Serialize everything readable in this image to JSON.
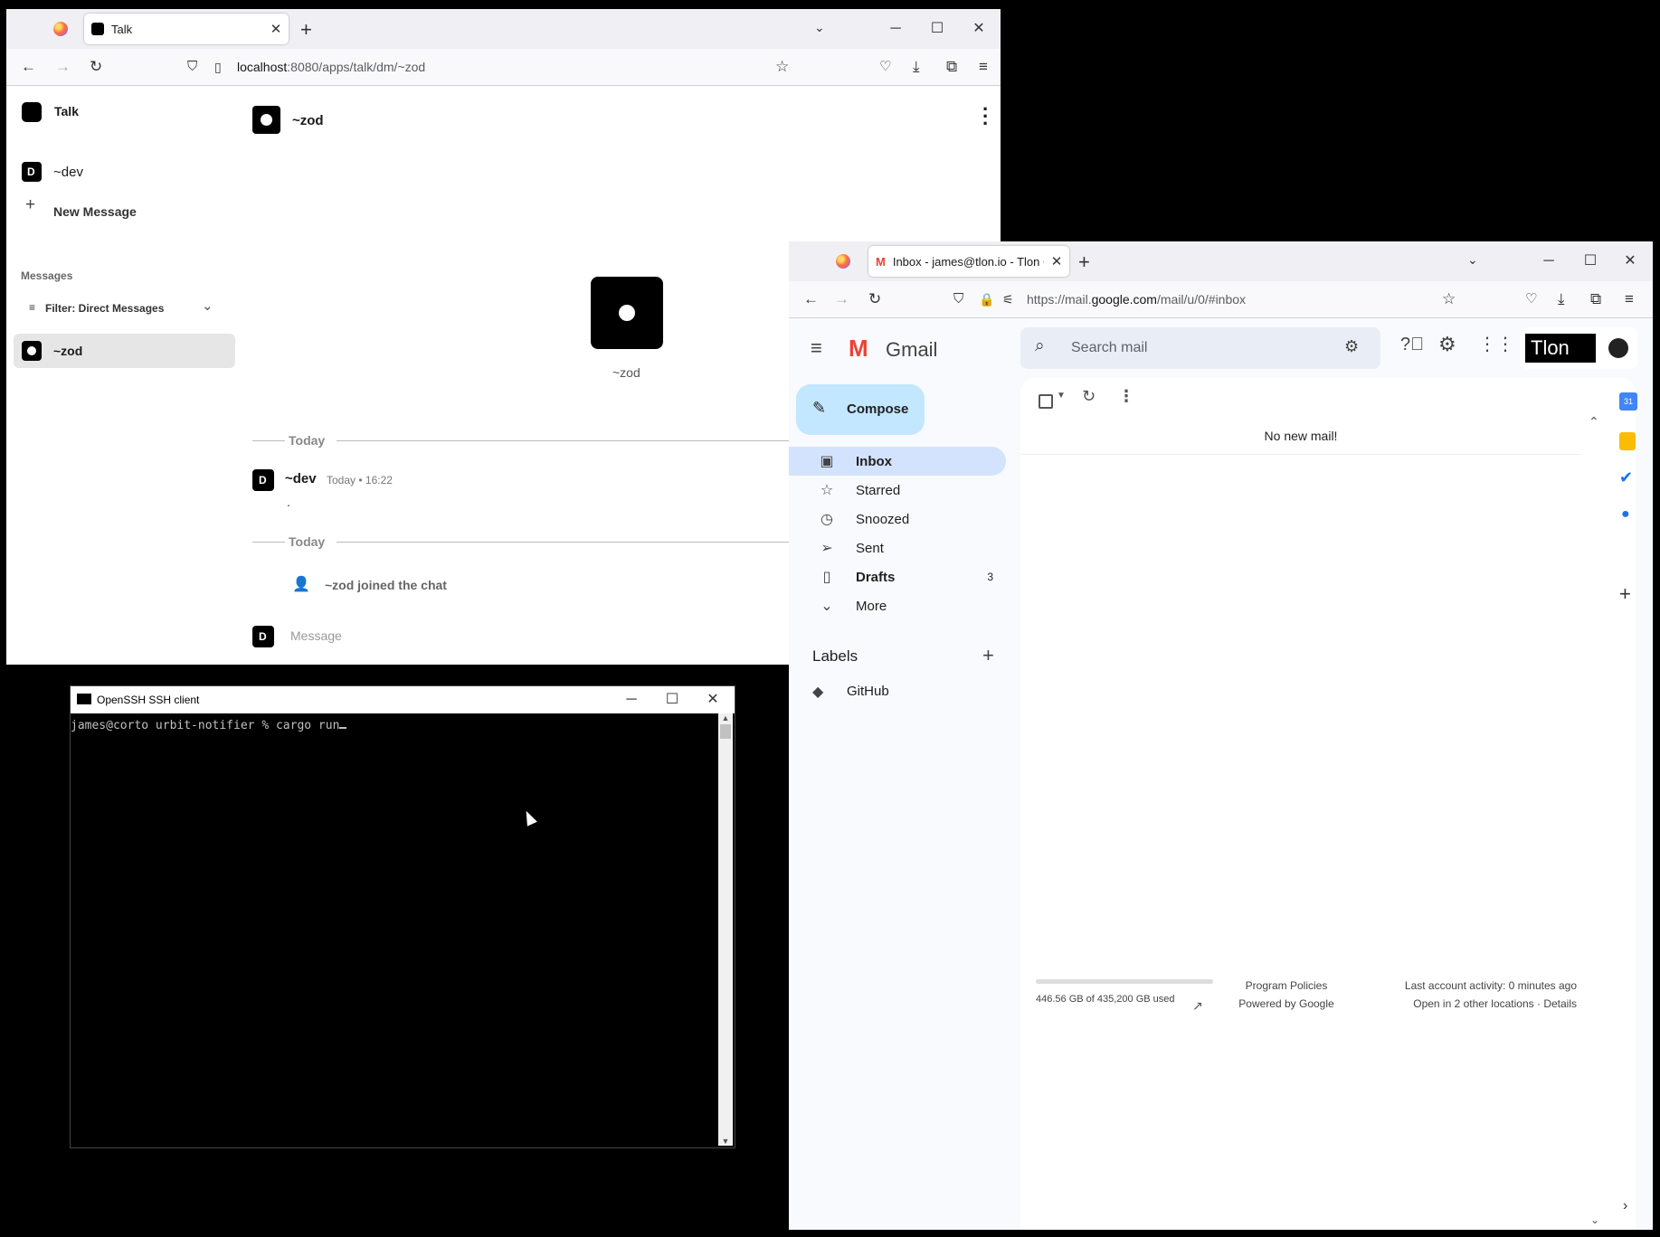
{
  "talk": {
    "tab_title": "Talk",
    "url_host": "localhost",
    "url_rest": ":8080/apps/talk/dm/~zod",
    "app_name": "Talk",
    "sidebar": {
      "dev_label": "~dev",
      "new_message": "New Message",
      "messages_header": "Messages",
      "filter_label": "Filter: Direct Messages",
      "zod_label": "~zod"
    },
    "chat": {
      "header_name": "~zod",
      "profile_name": "~zod",
      "divider1": "Today",
      "author": "~dev",
      "meta": "Today • 16:22",
      "body": ".",
      "divider2": "Today",
      "join_text": "~zod joined the chat",
      "input_placeholder": "Message"
    }
  },
  "gmail": {
    "tab_title": "Inbox - james@tlon.io - Tlon C",
    "url_prefix": "https://mail.",
    "url_host": "google.com",
    "url_rest": "/mail/u/0/#inbox",
    "brand": "Gmail",
    "search_placeholder": "Search mail",
    "account_badge": "Tlon",
    "compose_label": "Compose",
    "nav": [
      {
        "label": "Inbox",
        "icon": "inbox-icon",
        "bold": true,
        "count": ""
      },
      {
        "label": "Starred",
        "icon": "star-icon",
        "bold": false,
        "count": ""
      },
      {
        "label": "Snoozed",
        "icon": "clock-icon",
        "bold": false,
        "count": ""
      },
      {
        "label": "Sent",
        "icon": "send-icon",
        "bold": false,
        "count": ""
      },
      {
        "label": "Drafts",
        "icon": "draft-icon",
        "bold": true,
        "count": "3"
      },
      {
        "label": "More",
        "icon": "chevron-down-icon",
        "bold": false,
        "count": ""
      }
    ],
    "labels_header": "Labels",
    "label_items": [
      "GitHub"
    ],
    "empty_text": "No new mail!",
    "storage_text": "446.56 GB of 435,200 GB used",
    "storage_fraction": 1.0,
    "program_policies": "Program Policies",
    "powered_by": "Powered by Google",
    "last_activity": "Last account activity: 0 minutes ago",
    "open_locations": "Open in 2 other locations · Details",
    "accent": "#0b57d0",
    "inbox_highlight": "#d3e3fd",
    "compose_bg": "#c2e7ff"
  },
  "terminal": {
    "title": "OpenSSH SSH client",
    "prompt_line": "james@corto urbit-notifier % cargo run"
  }
}
